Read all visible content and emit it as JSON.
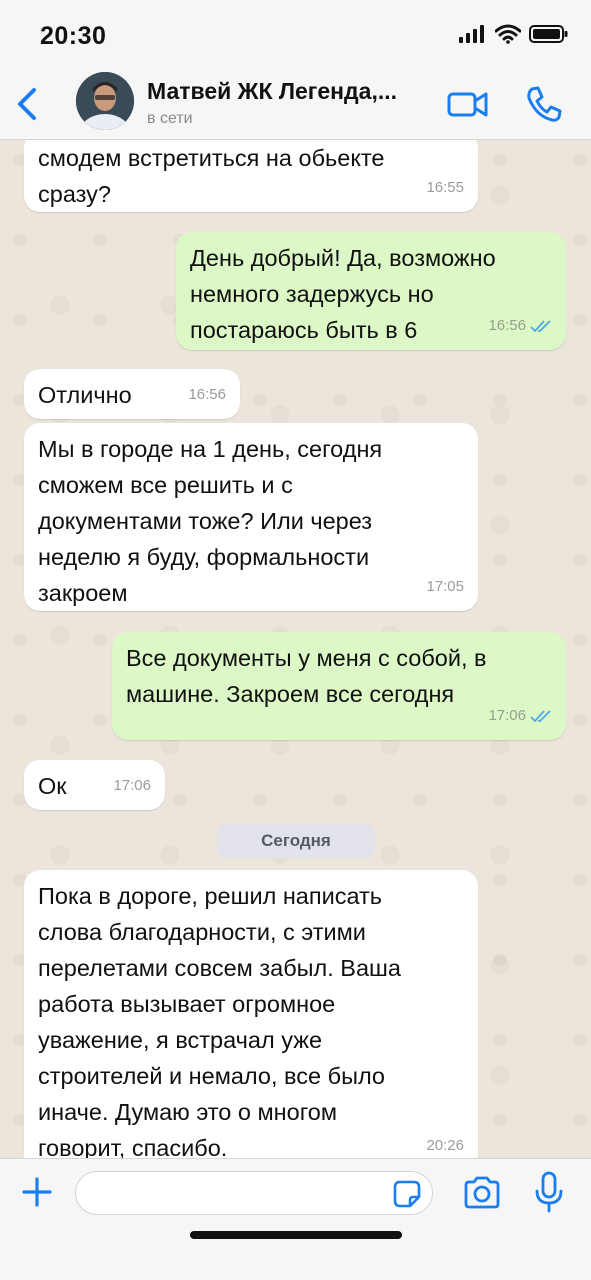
{
  "status_bar": {
    "time": "20:30"
  },
  "header": {
    "contact_name": "Матвей ЖК Легенда,...",
    "contact_status": "в сети"
  },
  "messages": [
    {
      "direction": "in",
      "text": "смодем встретиться на обьекте\nсразу?",
      "time": "16:55"
    },
    {
      "direction": "out",
      "text": "День добрый! Да, возможно\nнемного задержусь но\nпостараюсь быть в 6",
      "time": "16:56"
    },
    {
      "direction": "in",
      "text": "Отлично",
      "time": "16:56"
    },
    {
      "direction": "in",
      "text": "Мы в городе на 1 день, сегодня\nсможем все решить и с\nдокументами тоже? Или через\nнеделю я буду, формальности\nзакроем",
      "time": "17:05"
    },
    {
      "direction": "out",
      "text": "Все документы у меня с собой, в\nмашине. Закроем все сегодня",
      "time": "17:06"
    },
    {
      "direction": "in",
      "text": "Ок",
      "time": "17:06"
    },
    {
      "direction": "in",
      "text": "Пока в дороге, решил написать\nслова благодарности, с этими\nперелетами совсем забыл. Ваша\nработа вызывает огромное\nуважение, я встрачал уже\nстроителей и немало, все было\nиначе. Думаю это о многом\nговорит, спасибо.",
      "time": "20:26"
    }
  ],
  "date_divider": "Сегодня",
  "input": {
    "value": "",
    "placeholder": ""
  },
  "colors": {
    "accent": "#1a7df0",
    "outgoing_bubble": "#dcf8c6",
    "incoming_bubble": "#ffffff",
    "read_ticks": "#4fa8e8"
  },
  "icons": {
    "back": "chevron-left-icon",
    "video": "video-camera-icon",
    "call": "phone-icon",
    "plus": "plus-icon",
    "sticker": "sticker-icon",
    "camera": "camera-icon",
    "mic": "microphone-icon"
  }
}
